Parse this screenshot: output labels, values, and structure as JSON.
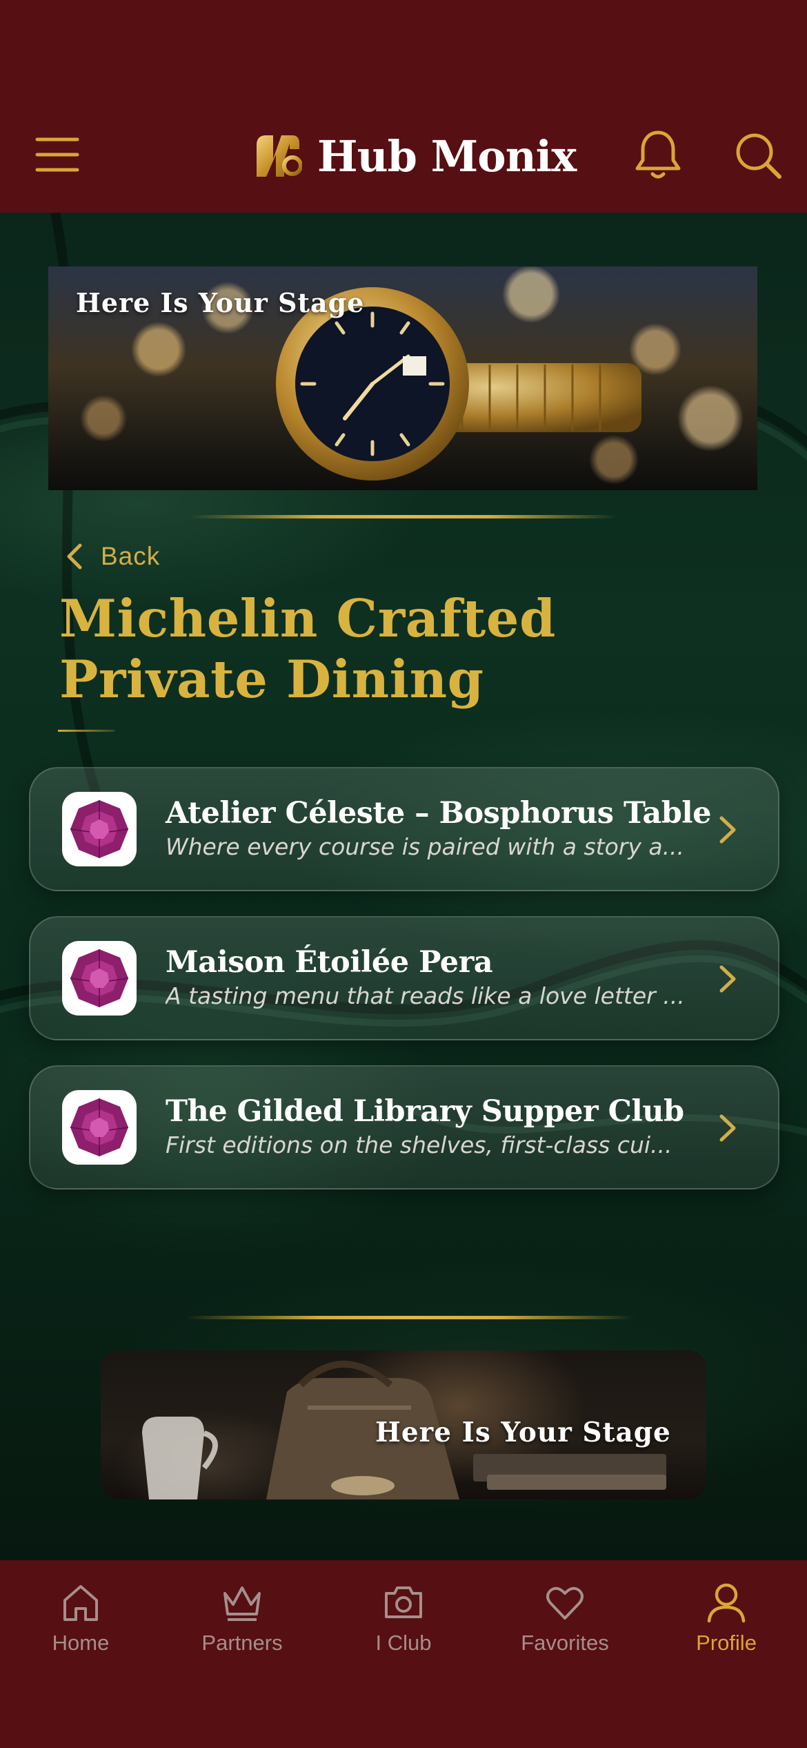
{
  "app": {
    "name": "Hub Monix"
  },
  "header": {
    "menu_icon": "hamburger-menu-icon",
    "bell_icon": "bell-icon",
    "search_icon": "search-icon"
  },
  "banner_top": {
    "title": "Here Is Your Stage"
  },
  "back": {
    "label": "Back"
  },
  "page": {
    "title": "Michelin Crafted Private Dining"
  },
  "list": [
    {
      "title": "Atelier Céleste – Bosphorus Table",
      "subtitle": "Where every course is paired with a story a..."
    },
    {
      "title": "Maison Étoilée Pera",
      "subtitle": "A tasting menu that reads like a love letter ..."
    },
    {
      "title": "The Gilded Library Supper Club",
      "subtitle": "First editions on the shelves, first-class cui..."
    }
  ],
  "banner_bottom": {
    "title": "Here Is Your Stage"
  },
  "nav": {
    "items": [
      {
        "label": "Home",
        "icon": "home-icon"
      },
      {
        "label": "Partners",
        "icon": "crown-icon"
      },
      {
        "label": "I Club",
        "icon": "camera-icon"
      },
      {
        "label": "Favorites",
        "icon": "heart-icon"
      },
      {
        "label": "Profile",
        "icon": "user-icon"
      }
    ],
    "active": "Profile"
  },
  "colors": {
    "header_bg": "#560f12",
    "accent_gold": "#d9b33f",
    "velvet_green": "#0b2a1c",
    "nav_inactive": "#a58f8c"
  }
}
